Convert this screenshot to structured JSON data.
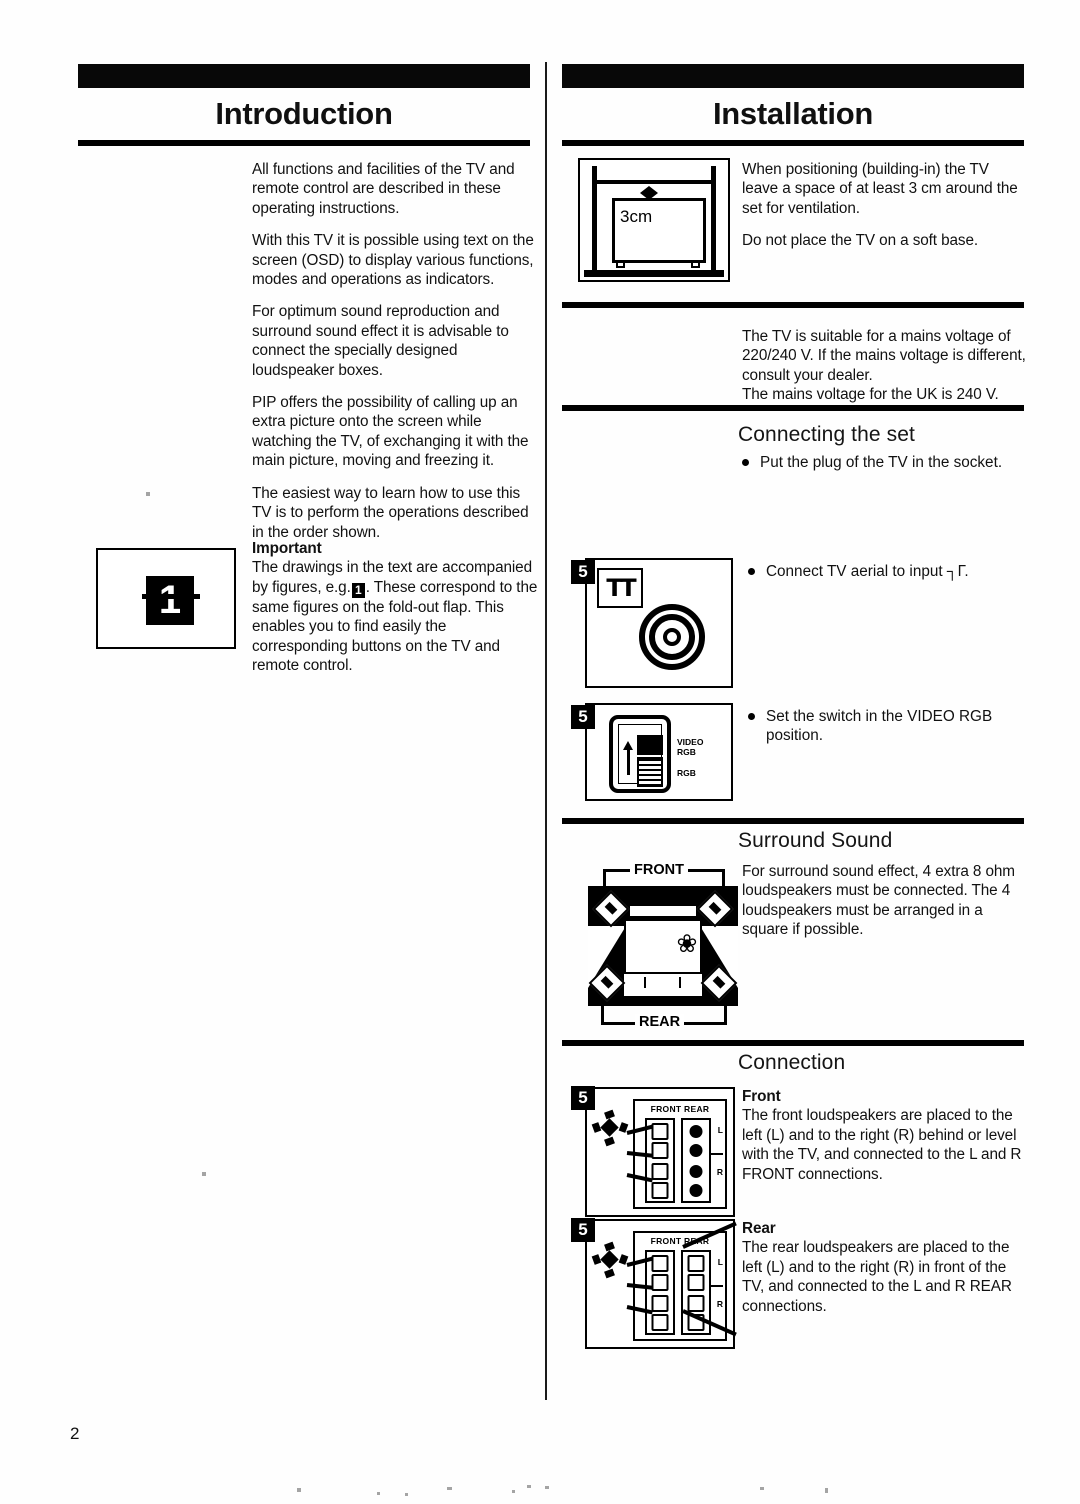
{
  "page": {
    "number": "2"
  },
  "left_column": {
    "title": "Introduction",
    "paragraphs": [
      "All functions and facilities of the TV and remote control are described in these operating instructions.",
      "With this TV it is possible using text on the screen (OSD) to display various functions, modes and operations as indicators.",
      "For optimum sound reproduction and surround sound effect it is advisable to connect the specially designed loudspeaker boxes.",
      "PIP offers the possibility of calling up an extra picture onto the screen while watching the TV, of exchanging it with the main picture, moving and freezing it.",
      "The easiest way to learn how to use this TV is to perform the operations described in the order shown."
    ],
    "important": {
      "heading": "Important",
      "text_before_figure": "The drawings in the text are accompanied by figures, e.g.",
      "figure_inline": "1",
      "text_after_figure": ". These correspond to the same figures on the fold-out flap. This enables you to find easily the corresponding buttons on the TV and remote control."
    },
    "figure_one": {
      "number": "1"
    }
  },
  "right_column": {
    "title": "Installation",
    "ventilation": {
      "figure_label": "3cm",
      "paragraphs": [
        "When positioning (building-in) the TV leave a space of at least 3 cm around the set for ventilation.",
        "Do not place the TV on a soft base."
      ]
    },
    "mains": {
      "paragraphs": [
        "The TV is suitable for a mains voltage of 220/240 V. If the mains voltage is different, consult your dealer.",
        "The mains voltage for the UK is 240 V."
      ]
    },
    "connecting_the_set": {
      "heading": "Connecting the set",
      "bullets": [
        "Put the plug of the TV in the socket."
      ],
      "steps": [
        {
          "marker": "5",
          "figure_symbol": "TT",
          "bullet": "Connect TV aerial to input ┐Γ."
        },
        {
          "marker": "5",
          "switch_labels": [
            "VIDEO",
            "RGB",
            "RGB"
          ],
          "bullet": "Set the switch in the VIDEO RGB position."
        }
      ]
    },
    "surround_sound": {
      "heading": "Surround Sound",
      "diagram": {
        "front_label": "FRONT",
        "rear_label": "REAR"
      },
      "paragraphs": [
        "For surround sound effect, 4 extra 8 ohm loudspeakers must be connected. The 4 loudspeakers must be arranged in a square if possible."
      ]
    },
    "connection": {
      "heading": "Connection",
      "items": [
        {
          "marker": "5",
          "sub_heading": "Front",
          "figure_caption": "FRONT REAR",
          "figure_l": "L",
          "figure_r": "R",
          "text": "The front loudspeakers are placed to the left (L) and to the right (R) behind or level with the TV, and connected to the L and R FRONT connections."
        },
        {
          "marker": "5",
          "sub_heading": "Rear",
          "figure_caption": "FRONT REAR",
          "figure_l": "L",
          "figure_r": "R",
          "text": "The rear loudspeakers are placed to the left (L) and to the right (R) in front of the TV, and connected to the L and R REAR connections."
        }
      ]
    }
  },
  "colors": {
    "ink": "#0d0d0d",
    "paper": "#ffffff"
  }
}
